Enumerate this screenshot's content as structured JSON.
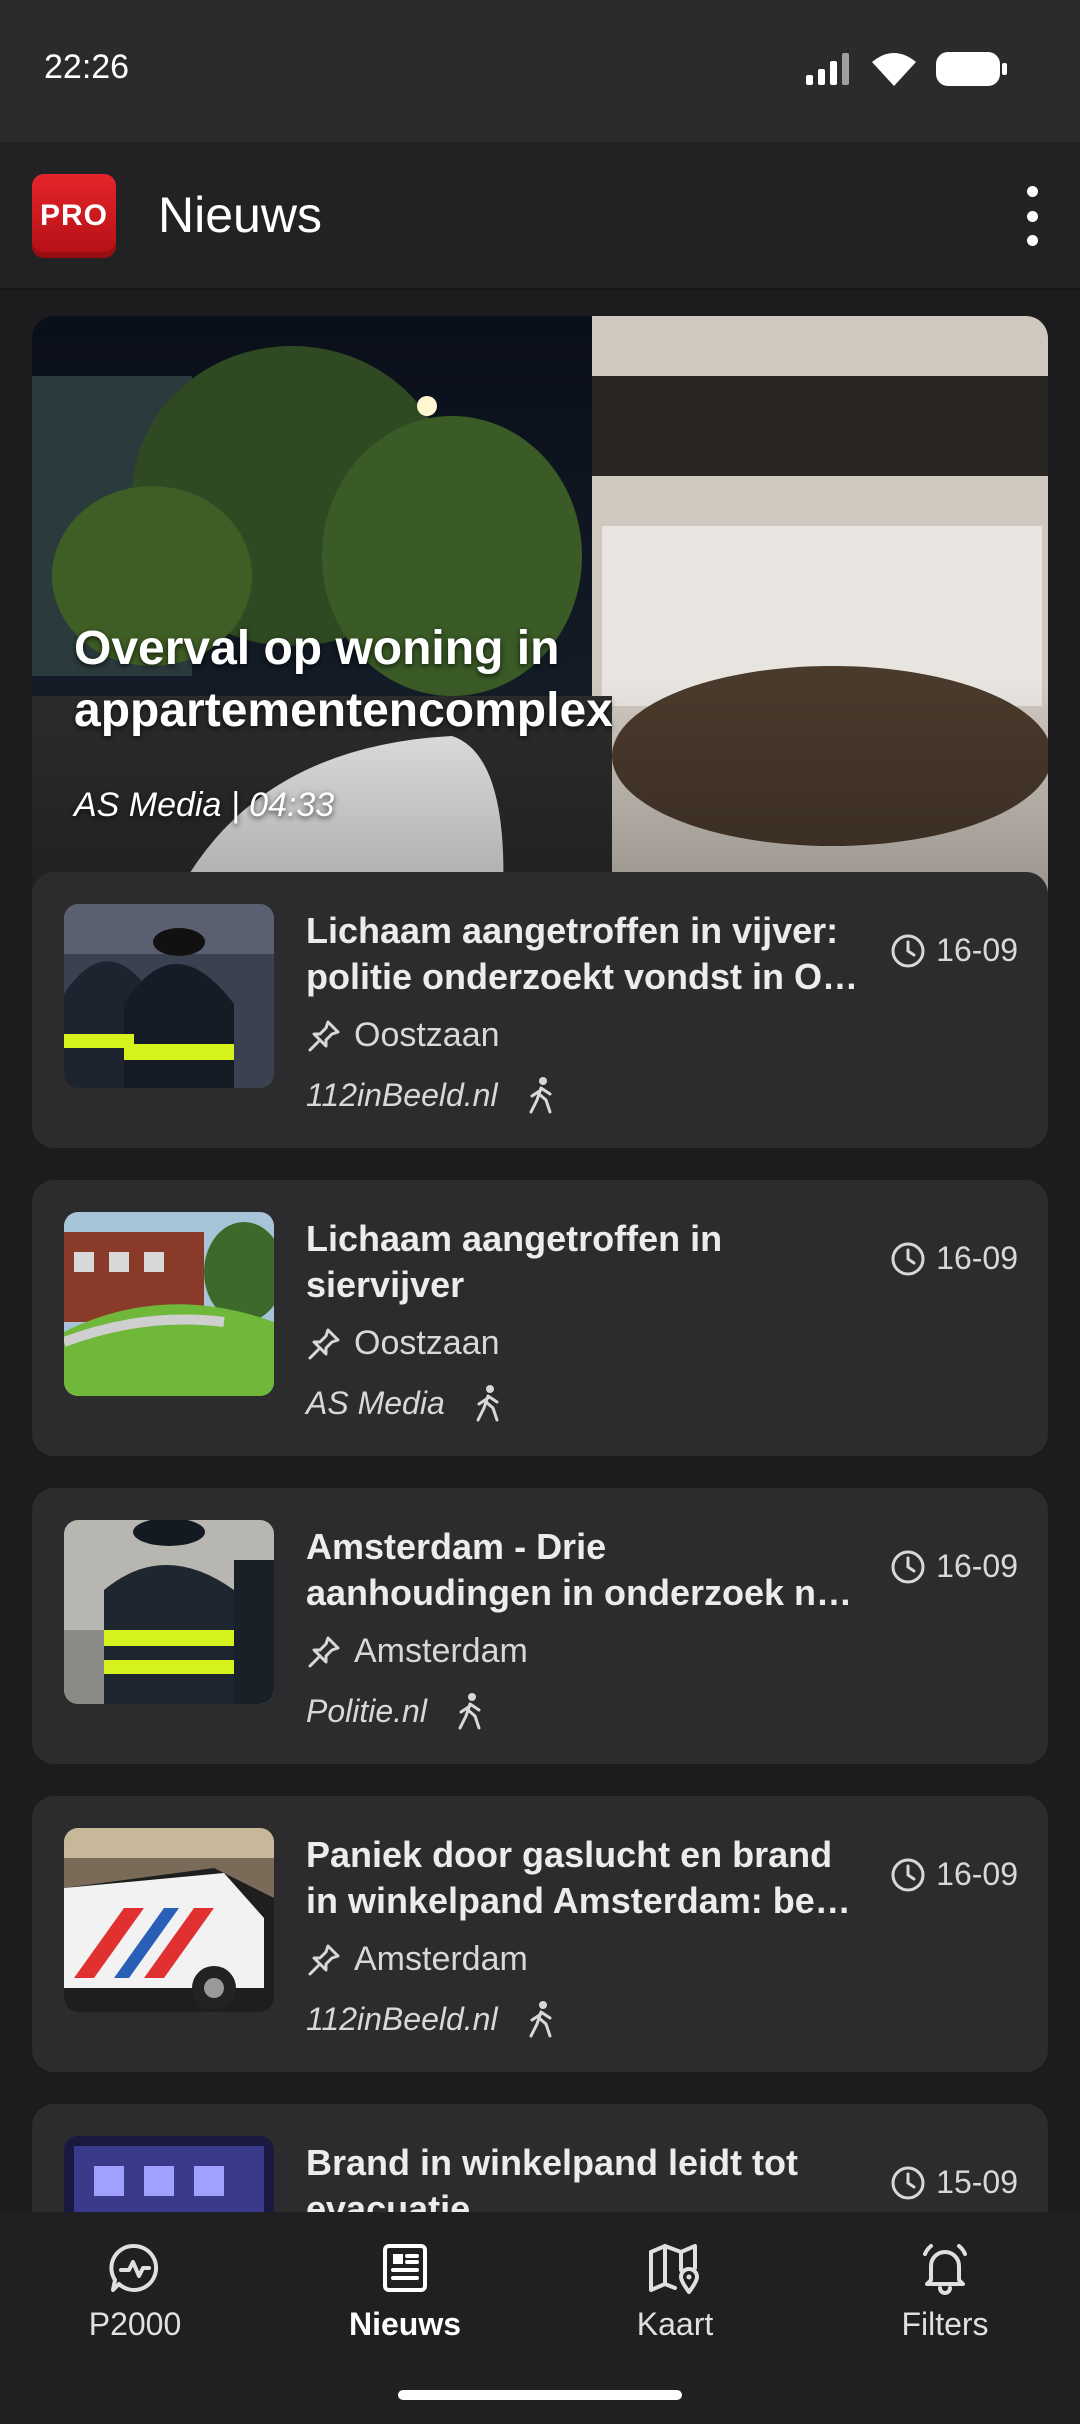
{
  "status_bar": {
    "time": "22:26",
    "icons": [
      "signal-icon",
      "wifi-icon",
      "battery-icon"
    ]
  },
  "app_bar": {
    "logo_text": "PRO",
    "title": "Nieuws",
    "menu_icon": "more-vert-icon"
  },
  "hero": {
    "title_line1": "Overval op woning in",
    "title_line2": "appartementencomplex",
    "meta": "AS Media | 04:33"
  },
  "articles": [
    {
      "title_line1": "Lichaam aangetroffen in vijver:",
      "title_line2": "politie onderzoekt vondst in Oostzaan",
      "date": "16-09",
      "location": "Oostzaan",
      "source": "112inBeeld.nl"
    },
    {
      "title_line1": "Lichaam aangetroffen in",
      "title_line2": "siervijver",
      "date": "16-09",
      "location": "Oostzaan",
      "source": "AS Media"
    },
    {
      "title_line1": "Amsterdam - Drie",
      "title_line2": "aanhoudingen in onderzoek naar",
      "date": "16-09",
      "location": "Amsterdam",
      "source": "Politie.nl"
    },
    {
      "title_line1": "Paniek door gaslucht en brand",
      "title_line2": "in winkelpand Amsterdam: bewoners",
      "date": "16-09",
      "location": "Amsterdam",
      "source": "112inBeeld.nl"
    },
    {
      "title_line1": "Brand in winkelpand leidt tot",
      "title_line2": "evacuatie",
      "date": "15-09",
      "location": "",
      "source": ""
    }
  ],
  "bottom_nav": [
    {
      "label": "P2000",
      "icon": "chat-bubble-pulse-icon",
      "active": false
    },
    {
      "label": "Nieuws",
      "icon": "newspaper-icon",
      "active": true
    },
    {
      "label": "Kaart",
      "icon": "map-pin-icon",
      "active": false
    },
    {
      "label": "Filters",
      "icon": "bell-icon",
      "active": false
    }
  ],
  "colors": {
    "background": "#1c1c1e",
    "card": "#2c2c2e",
    "logo_red": "#d8161c",
    "text": "#ffffff"
  }
}
